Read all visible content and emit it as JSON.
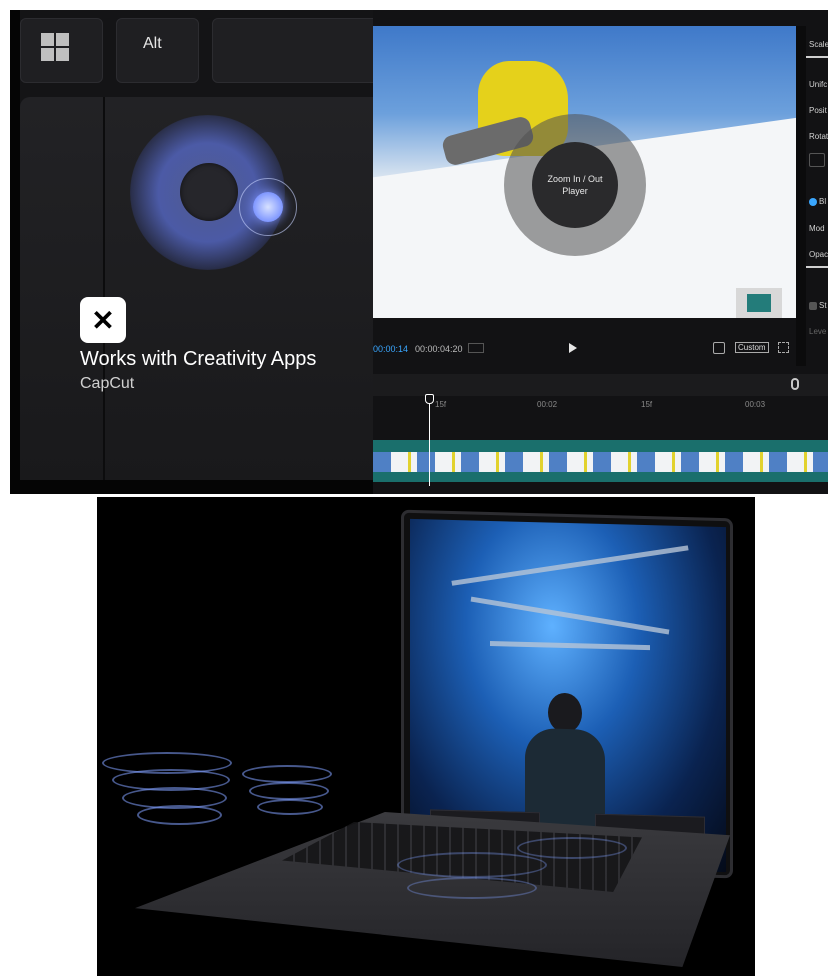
{
  "keyboard": {
    "alt_label": "Alt"
  },
  "promo": {
    "title": "Works with Creativity Apps",
    "subtitle": "CapCut",
    "logo_glyph": "✕"
  },
  "player": {
    "overlay_label": "Zoom In / Out Player"
  },
  "transport": {
    "current_time": "00:00:14",
    "total_time": "00:00:04:20",
    "ratio_label": "Custom"
  },
  "timeline": {
    "ruler_labels": [
      "15f",
      "00:02",
      "15f",
      "00:03"
    ]
  },
  "properties": {
    "scale": "Scale",
    "uniform": "Unifc",
    "position": "Posit",
    "rotate": "Rotat",
    "blend": "Bl",
    "mode": "Mod",
    "opacity": "Opac",
    "stabilize": "St",
    "level": "Leve"
  },
  "colors": {
    "accent": "#3aa7ff",
    "track": "#1a6f6c",
    "glow": "#7e96ff"
  }
}
